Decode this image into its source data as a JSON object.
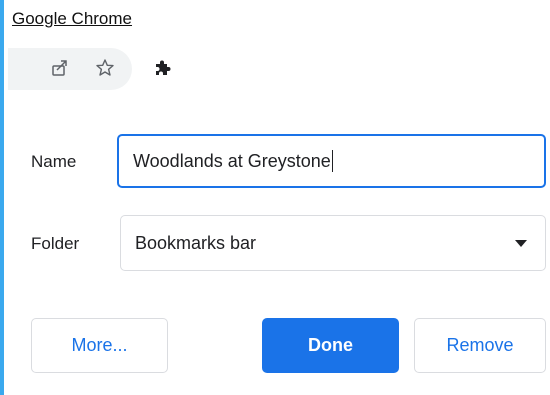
{
  "caption": {
    "text": "Google Chrome"
  },
  "toolbar": {
    "icons": [
      "share-icon",
      "bookmark-star-icon",
      "extensions-icon"
    ]
  },
  "bookmark_dialog": {
    "name_label": "Name",
    "name_value": "Woodlands at Greystone",
    "folder_label": "Folder",
    "folder_value": "Bookmarks bar",
    "buttons": {
      "more": "More...",
      "done": "Done",
      "remove": "Remove"
    }
  },
  "colors": {
    "accent": "#1a73e8",
    "border": "#dadce0",
    "window_frame": "#3aa9ee",
    "toolbar_bg": "#f1f3f4"
  }
}
